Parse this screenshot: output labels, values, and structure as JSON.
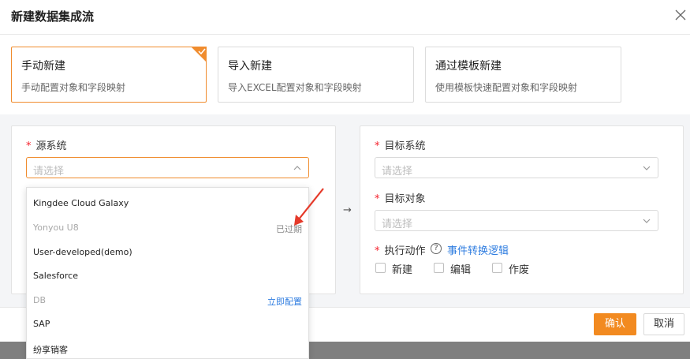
{
  "modal": {
    "title": "新建数据集成流",
    "close_icon": "close-icon"
  },
  "modes": [
    {
      "title": "手动新建",
      "desc": "手动配置对象和字段映射",
      "selected": true
    },
    {
      "title": "导入新建",
      "desc": "导入EXCEL配置对象和字段映射",
      "selected": false
    },
    {
      "title": "通过模板新建",
      "desc": "使用模板快速配置对象和字段映射",
      "selected": false
    }
  ],
  "source": {
    "label": "源系统",
    "placeholder": "请选择",
    "options": [
      {
        "name": "Kingdee Cloud Galaxy",
        "tag": "",
        "disabled": false
      },
      {
        "name": "Yonyou U8",
        "tag": "已过期",
        "disabled": true
      },
      {
        "name": "User-developed(demo)",
        "tag": "",
        "disabled": false
      },
      {
        "name": "Salesforce",
        "tag": "",
        "disabled": false
      },
      {
        "name": "DB",
        "tag": "立即配置",
        "disabled": true
      },
      {
        "name": "SAP",
        "tag": "",
        "disabled": false
      },
      {
        "name": "纷享销客",
        "tag": "",
        "disabled": false
      }
    ]
  },
  "target": {
    "system_label": "目标系统",
    "system_placeholder": "请选择",
    "object_label": "目标对象",
    "object_placeholder": "请选择",
    "action_label": "执行动作",
    "action_help_icon": "question-circle-icon",
    "action_link": "事件转换逻辑",
    "actions": [
      "新建",
      "编辑",
      "作废"
    ]
  },
  "arrow_symbol": "→",
  "buttons": {
    "confirm": "确认",
    "cancel": "取消"
  },
  "colors": {
    "accent": "#f28a20",
    "link": "#2f7de0",
    "required": "#f5222d"
  }
}
